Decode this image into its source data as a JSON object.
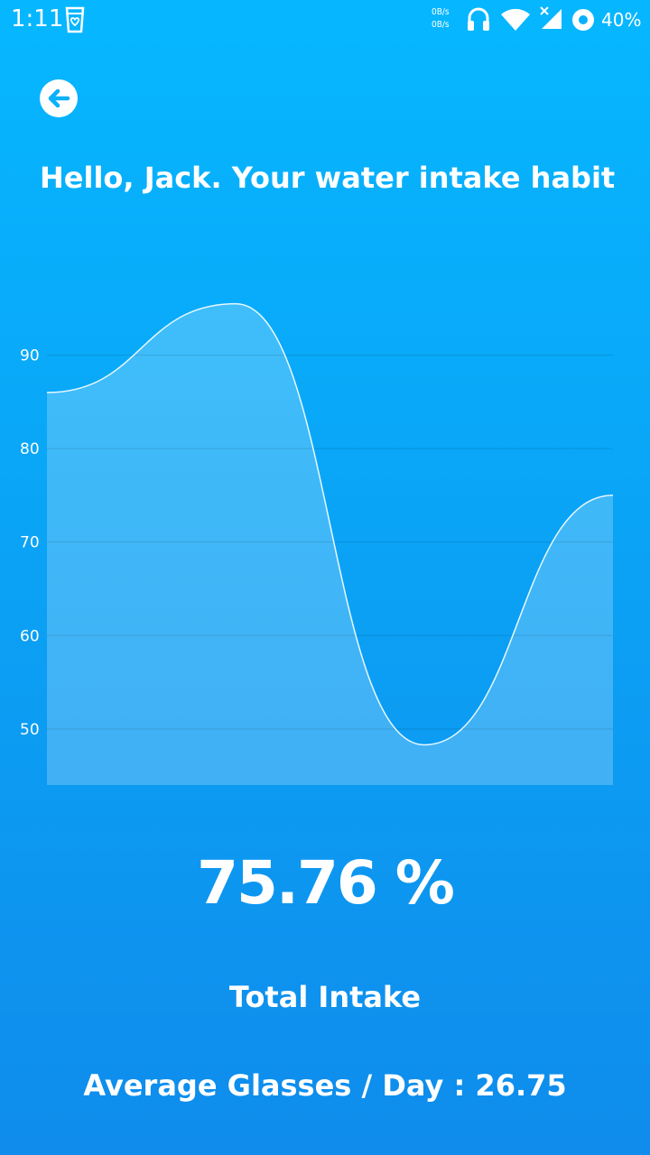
{
  "status_bar": {
    "time": "1:11",
    "net_up": "0B/s",
    "net_down": "0B/s",
    "battery": "40%",
    "icons": [
      "cup-heart-icon",
      "headphones-icon",
      "wifi-icon",
      "signal-off-icon",
      "record-icon"
    ]
  },
  "header": {
    "back_icon": "arrow-left-icon",
    "greeting": "Hello, Jack. Your water intake habit"
  },
  "chart_data": {
    "type": "area",
    "title": "",
    "xlabel": "",
    "ylabel": "",
    "y_ticks": [
      90,
      80,
      70,
      60,
      50
    ],
    "ylim": [
      44,
      100
    ],
    "grid": true,
    "legend": "none",
    "series": [
      {
        "values": [
          86,
          95.5,
          48.3,
          75
        ]
      }
    ],
    "colors": {
      "fill": "rgba(255,255,255,0.22)",
      "line": "#e6f7ff",
      "grid": "rgba(0,0,0,0.12)"
    }
  },
  "summary": {
    "percent": "75.76 %",
    "total_label": "Total Intake",
    "avg_label": "Average Glasses / Day : ",
    "avg_value": "26.75"
  },
  "colors": {
    "bg_top": "#06b7ff",
    "bg_bottom": "#0f8cec",
    "accent": "#1aa7f7"
  }
}
